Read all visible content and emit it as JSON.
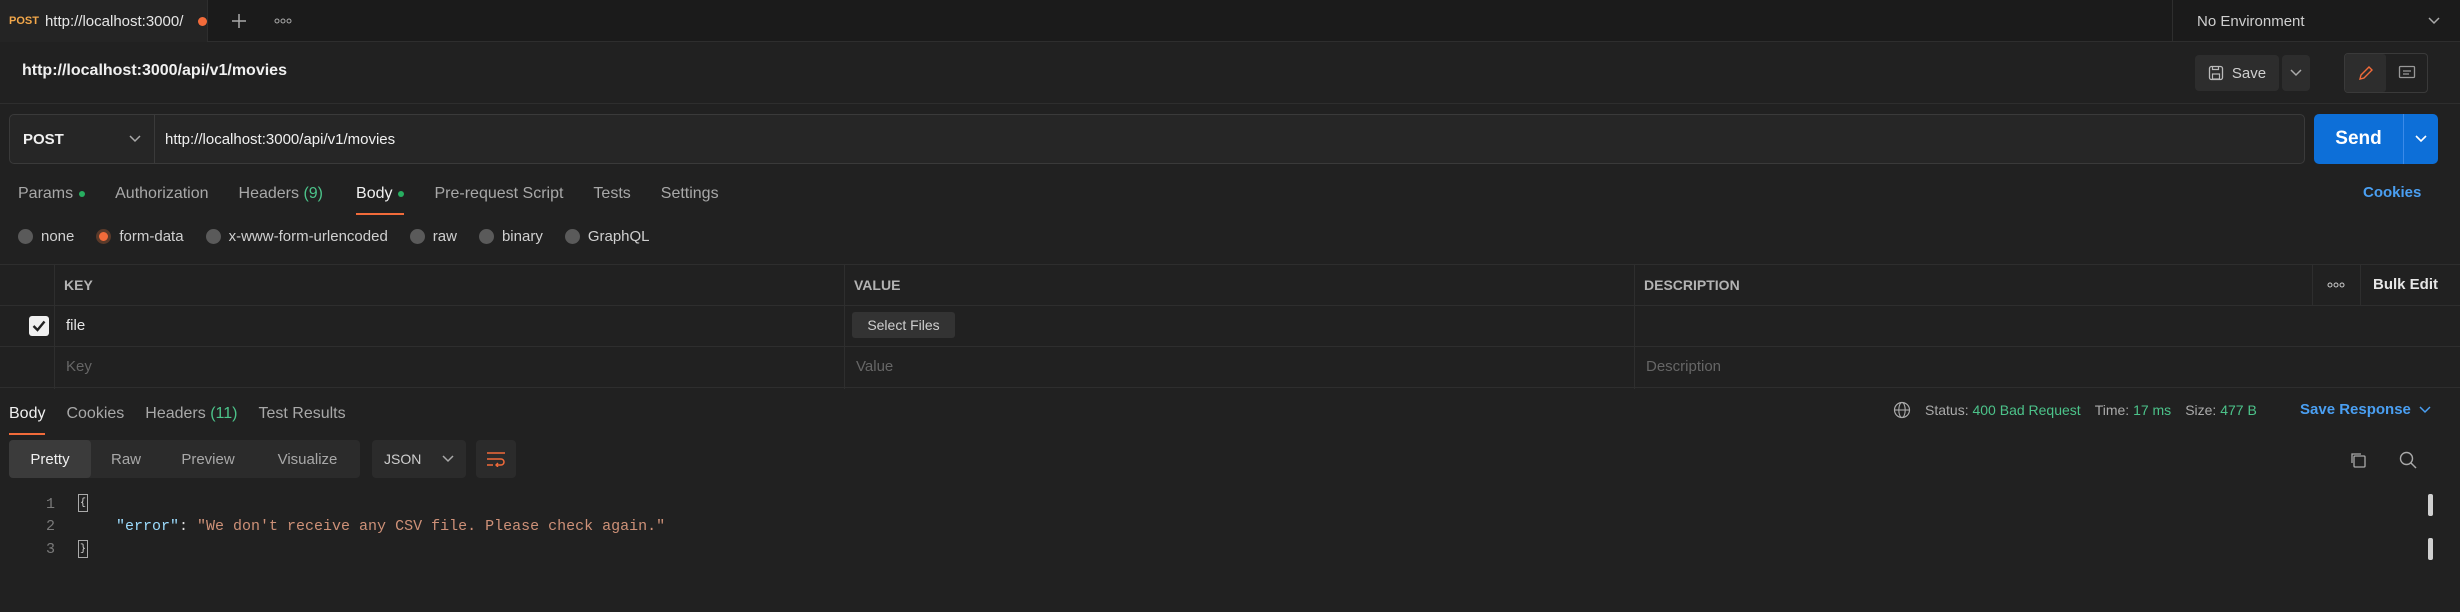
{
  "tab": {
    "method": "POST",
    "title": "http://localhost:3000/"
  },
  "environment": {
    "selected": "No Environment"
  },
  "request": {
    "title": "http://localhost:3000/api/v1/movies",
    "method": "POST",
    "url": "http://localhost:3000/api/v1/movies",
    "save_label": "Save",
    "send_label": "Send"
  },
  "request_tabs": [
    {
      "label": "Params",
      "dot": true
    },
    {
      "label": "Authorization"
    },
    {
      "label": "Headers",
      "count": "(9)"
    },
    {
      "label": "Body",
      "dot": true,
      "active": true
    },
    {
      "label": "Pre-request Script"
    },
    {
      "label": "Tests"
    },
    {
      "label": "Settings"
    }
  ],
  "cookies_label": "Cookies",
  "body_types": [
    {
      "label": "none"
    },
    {
      "label": "form-data",
      "selected": true
    },
    {
      "label": "x-www-form-urlencoded"
    },
    {
      "label": "raw"
    },
    {
      "label": "binary"
    },
    {
      "label": "GraphQL"
    }
  ],
  "kv_table": {
    "columns": [
      "KEY",
      "VALUE",
      "DESCRIPTION"
    ],
    "bulk_edit": "Bulk Edit",
    "rows": [
      {
        "checked": true,
        "key": "file",
        "value_button": "Select Files",
        "description": ""
      }
    ],
    "placeholders": {
      "key": "Key",
      "value": "Value",
      "description": "Description"
    }
  },
  "response": {
    "tabs": [
      {
        "label": "Body",
        "active": true
      },
      {
        "label": "Cookies"
      },
      {
        "label": "Headers",
        "count": "(11)"
      },
      {
        "label": "Test Results"
      }
    ],
    "status_label": "Status:",
    "status_value": "400 Bad Request",
    "time_label": "Time:",
    "time_value": "17 ms",
    "size_label": "Size:",
    "size_value": "477 B",
    "save_response_label": "Save Response",
    "views": [
      "Pretty",
      "Raw",
      "Preview",
      "Visualize"
    ],
    "format": "JSON",
    "code": {
      "line_numbers": [
        "1",
        "2",
        "3"
      ],
      "key": "\"error\"",
      "colon": ": ",
      "value": "\"We don't receive any CSV file. Please check again.\""
    }
  },
  "colors": {
    "accent": "#f26b3a",
    "send": "#0d6fd8",
    "link": "#4a9ff2",
    "success": "#4cc38a"
  }
}
